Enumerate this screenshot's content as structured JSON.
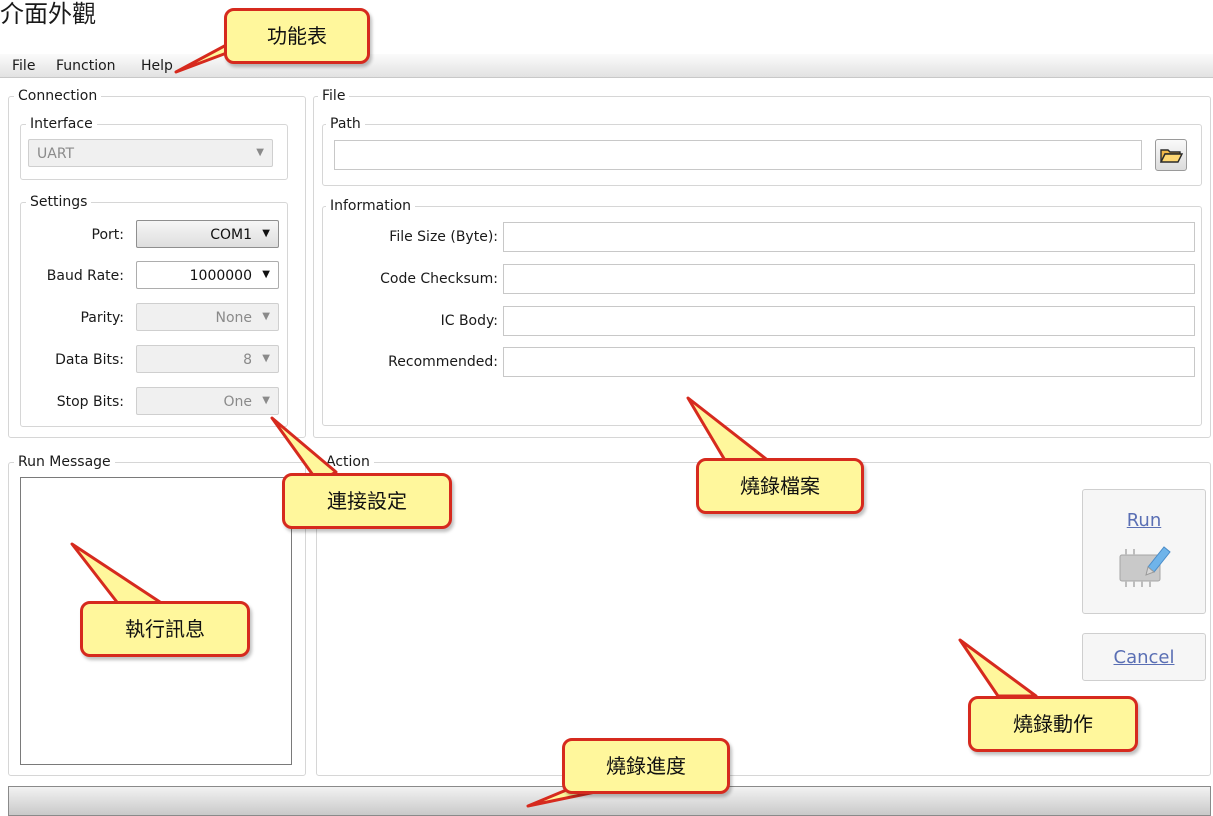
{
  "heading": "介面外觀",
  "menu": {
    "items": [
      "File",
      "Function",
      "Help"
    ]
  },
  "connection": {
    "title": "Connection",
    "interface": {
      "title": "Interface",
      "value": "UART"
    },
    "settings": {
      "title": "Settings",
      "rows": [
        {
          "label": "Port:",
          "value": "COM1"
        },
        {
          "label": "Baud Rate:",
          "value": "1000000"
        },
        {
          "label": "Parity:",
          "value": "None"
        },
        {
          "label": "Data Bits:",
          "value": "8"
        },
        {
          "label": "Stop Bits:",
          "value": "One"
        }
      ]
    }
  },
  "file": {
    "title": "File",
    "path": {
      "title": "Path",
      "value": ""
    },
    "information": {
      "title": "Information",
      "fields": [
        {
          "label": "File Size (Byte):",
          "value": ""
        },
        {
          "label": "Code Checksum:",
          "value": ""
        },
        {
          "label": "IC Body:",
          "value": ""
        },
        {
          "label": "Recommended:",
          "value": ""
        }
      ]
    }
  },
  "run_message": {
    "title": "Run Message"
  },
  "action": {
    "title": "Action",
    "run_label": "Run",
    "cancel_label": "Cancel"
  },
  "callouts": {
    "menu": "功能表",
    "connection": "連接設定",
    "file": "燒錄檔案",
    "message": "執行訊息",
    "action": "燒錄動作",
    "progress": "燒錄進度"
  },
  "colors": {
    "bubble_fill": "#fff79c",
    "bubble_border": "#d62a1e",
    "link_blue": "#5a6fb4"
  }
}
